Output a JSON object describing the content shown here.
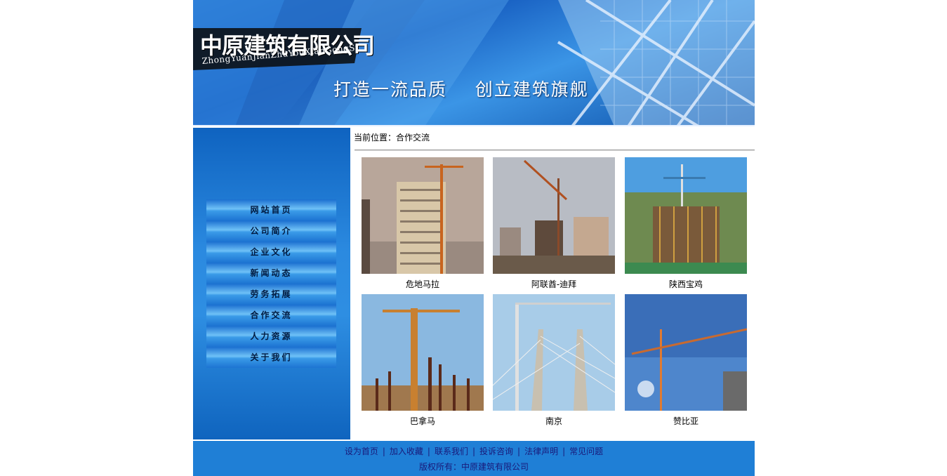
{
  "banner": {
    "logo_cn": "中原建筑有限公司",
    "logo_pinyin": "ZhongYuanJianZhuYouXianGongSi",
    "slogan": "打造一流品质    创立建筑旗舰"
  },
  "nav": {
    "items": [
      {
        "label": "网站首页"
      },
      {
        "label": "公司简介"
      },
      {
        "label": "企业文化"
      },
      {
        "label": "新闻动态"
      },
      {
        "label": "劳务拓展"
      },
      {
        "label": "合作交流"
      },
      {
        "label": "人力资源"
      },
      {
        "label": "关于我们"
      }
    ]
  },
  "main": {
    "breadcrumb_label": "当前位置：",
    "breadcrumb_value": "合作交流",
    "projects": [
      {
        "caption": "危地马拉"
      },
      {
        "caption": "阿联酋-迪拜"
      },
      {
        "caption": "陕西宝鸡"
      },
      {
        "caption": "巴拿马"
      },
      {
        "caption": "南京"
      },
      {
        "caption": "赞比亚"
      }
    ]
  },
  "footer": {
    "links": [
      "设为首页",
      "加入收藏",
      "联系我们",
      "投诉咨询",
      "法律声明",
      "常见问题"
    ],
    "separator": "|",
    "copyright": "版权所有：中原建筑有限公司"
  },
  "colors": {
    "banner_blue": "#1a63c4",
    "sidebar_blue": "#0f63c0",
    "footer_blue": "#1f7fd6",
    "footer_text": "#1a1a7a"
  }
}
